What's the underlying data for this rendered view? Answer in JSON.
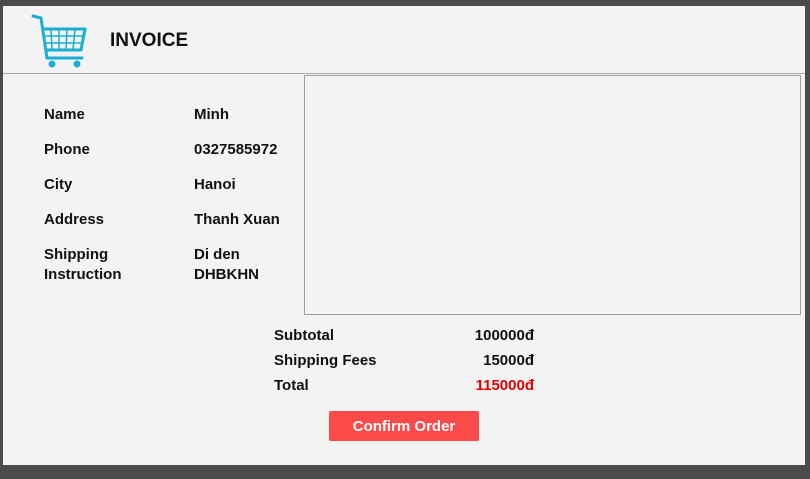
{
  "header": {
    "title": "INVOICE",
    "icon": "shopping-cart-icon"
  },
  "customer": {
    "name_label": "Name",
    "name_value": "Minh",
    "phone_label": "Phone",
    "phone_value": "0327585972",
    "city_label": "City",
    "city_value": "Hanoi",
    "address_label": "Address",
    "address_value": "Thanh Xuan",
    "shipping_label_1": "Shipping",
    "shipping_label_2": "Instruction",
    "shipping_value_1": "Di den",
    "shipping_value_2": "DHBKHN"
  },
  "summary": {
    "subtotal_label": "Subtotal",
    "subtotal_value": "100000đ",
    "shipping_fees_label": "Shipping Fees",
    "shipping_fees_value": "15000đ",
    "total_label": "Total",
    "total_value": "115000đ"
  },
  "actions": {
    "confirm_label": "Confirm Order"
  },
  "colors": {
    "accent": "#ff4a4a",
    "total": "#e60000",
    "icon": "#1ab0d6"
  }
}
